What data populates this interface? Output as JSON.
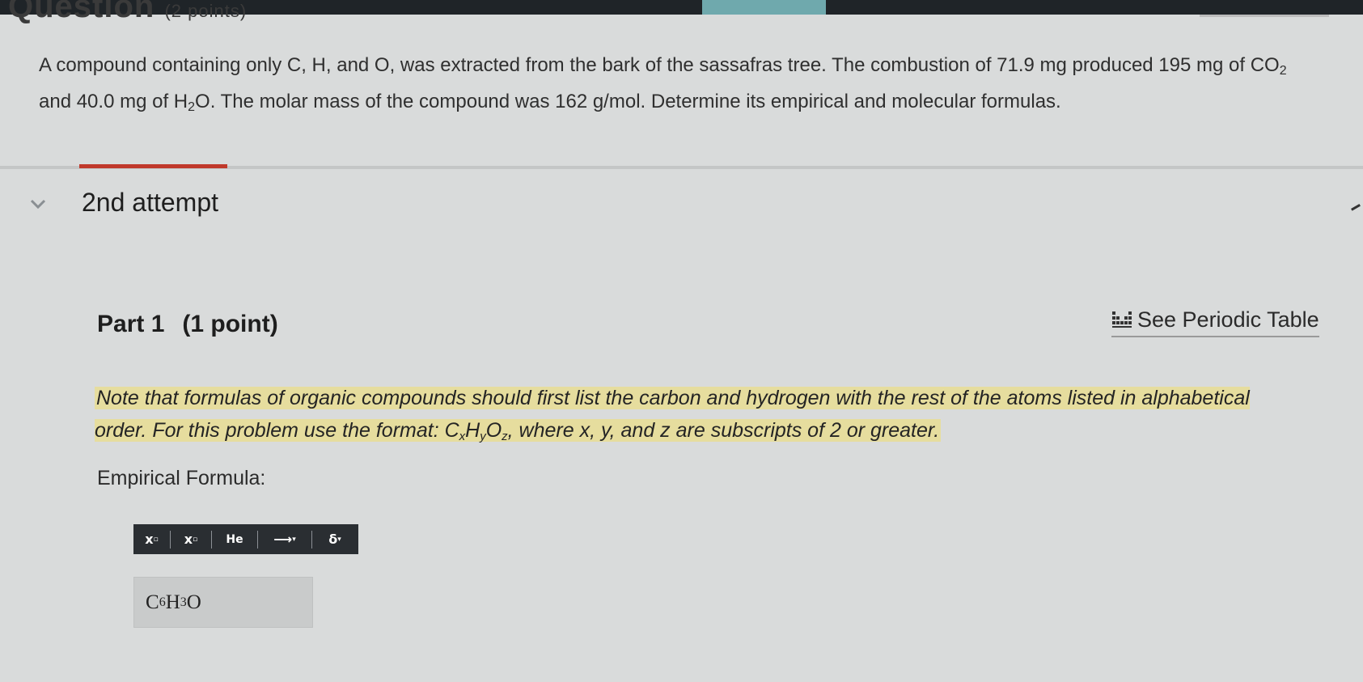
{
  "header": {
    "question_title_fragment": "Question",
    "points": "(2 points)"
  },
  "question": {
    "text_1": "A compound containing only C, H, and O, was extracted from the bark of the sassafras tree. The combustion of 71.9  mg produced 195  mg of CO",
    "co2_sub": "2",
    "text_2": "and 40.0  mg of H",
    "h2o_sub": "2",
    "text_3": "O. The molar mass of the compound was 162 g/mol. Determine its empirical and molecular formulas."
  },
  "attempt": {
    "label": "2nd attempt",
    "icon": "chevron-down-icon"
  },
  "part": {
    "title": "Part 1",
    "points": "(1 point)",
    "periodic_table_link": "See Periodic Table",
    "periodic_icon": "periodic-table-icon"
  },
  "note": {
    "text_1": "Note that formulas of organic compounds should first list the carbon and hydrogen with the rest of the atoms listed in alphabetical order. For this problem use the format: C",
    "x": "x",
    "h": "H",
    "y": "y",
    "o": "O",
    "z": "z",
    "text_2": ", where x, y, and z are subscripts of 2 or greater."
  },
  "empirical": {
    "label": "Empirical Formula:",
    "toolbar": {
      "superscript": "x",
      "subscript": "x",
      "element": "He",
      "arrow": "⟶",
      "delta": "δ"
    },
    "answer": {
      "c": "C",
      "c_sub": "6",
      "h": "H",
      "h_sub": "3",
      "o": "O"
    }
  },
  "colors": {
    "highlight": "#e6dd9e",
    "accent_red": "#c0392b",
    "toolbar_bg": "#2a2e32",
    "top_teal": "#6fa9ad"
  }
}
